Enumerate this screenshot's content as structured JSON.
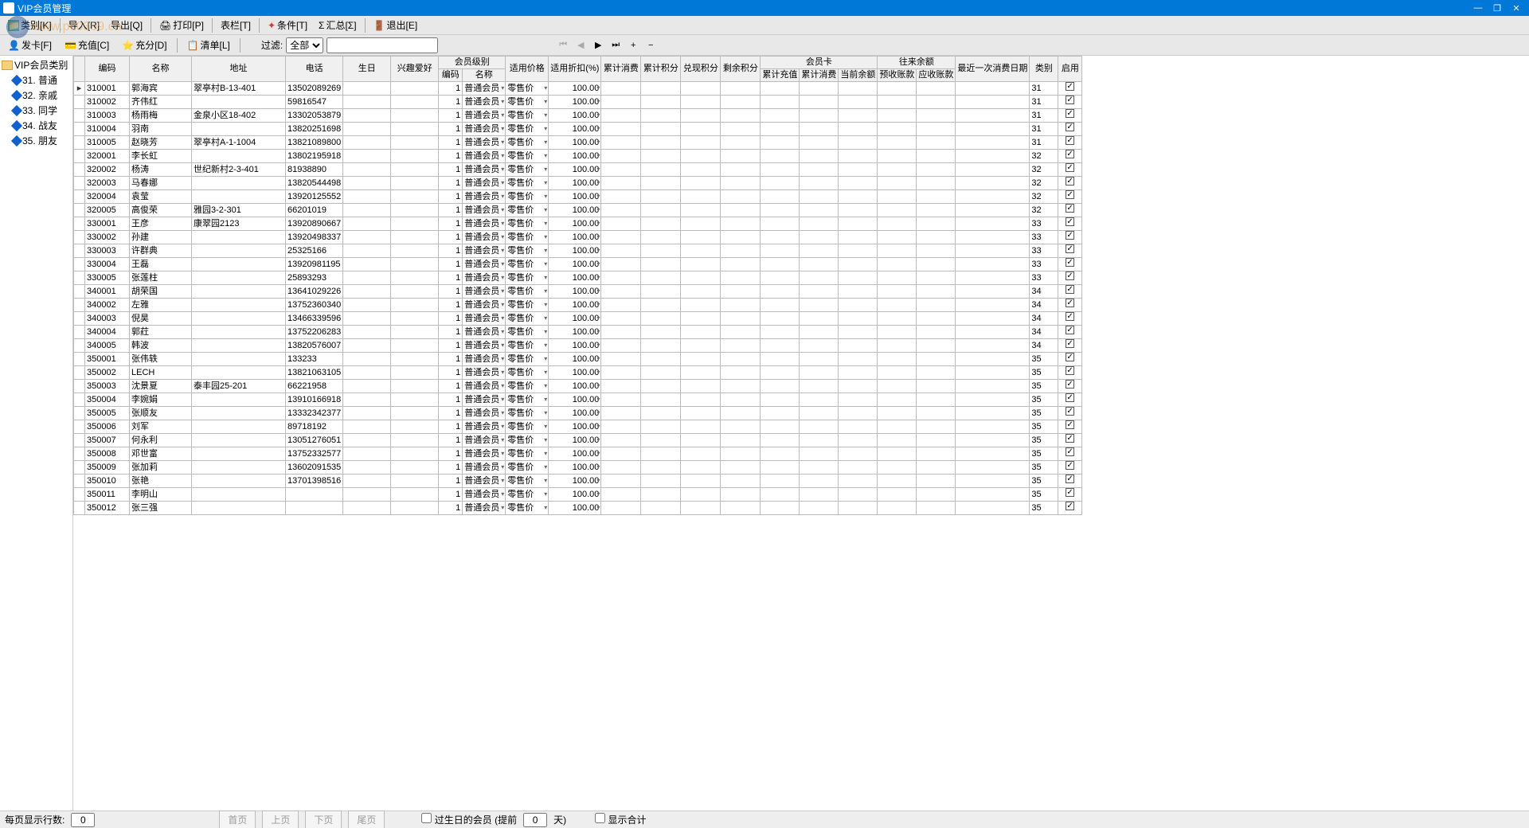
{
  "window": {
    "title": "VIP会员管理"
  },
  "watermark": "www.pc0359.cn",
  "toolbar1": {
    "category": "类别[K]",
    "import": "导入[R]",
    "export": "导出[Q]",
    "print": "打印[P]",
    "format": "表栏[T]",
    "condition": "条件[T]",
    "summary": "汇总[Σ]",
    "exit": "退出[E]"
  },
  "toolbar2": {
    "issue": "发卡[F]",
    "recharge": "充值[C]",
    "points": "充分[D]",
    "list": "清单[L]",
    "filter_label": "过滤:",
    "filter_all": "全部"
  },
  "tree": {
    "root": "VIP会员类别",
    "items": [
      "31. 普通",
      "32. 亲戚",
      "33. 同学",
      "34. 战友",
      "35. 朋友"
    ]
  },
  "cols": {
    "code": "编码",
    "name": "名称",
    "addr": "地址",
    "phone": "电话",
    "birth": "生日",
    "hobby": "兴趣爱好",
    "level": "会员级别",
    "lv_code": "编码",
    "lv_name": "名称",
    "price": "适用价格",
    "disc": "适用折扣(%)",
    "tot_cons": "累计消费",
    "tot_pts": "累计积分",
    "redeem": "兑现积分",
    "remain": "剩余积分",
    "card": "会员卡",
    "c_recharge": "累计充值",
    "c_cons": "累计消费",
    "c_bal": "当前余额",
    "bal": "往来余额",
    "prepay": "预收账款",
    "pay": "应收账款",
    "last": "最近一次消费日期",
    "cat": "类别",
    "enable": "启用"
  },
  "level_name": "普通会员",
  "price_name": "零售价",
  "disc_val": "100.00",
  "rows": [
    {
      "code": "310001",
      "name": "郭海宾",
      "addr": "翠亭村B-13-401",
      "phone": "13502089269",
      "cat": "31"
    },
    {
      "code": "310002",
      "name": "齐伟红",
      "addr": "",
      "phone": "59816547",
      "cat": "31"
    },
    {
      "code": "310003",
      "name": "杨雨梅",
      "addr": "金泉小区18-402",
      "phone": "13302053879",
      "cat": "31"
    },
    {
      "code": "310004",
      "name": "羽南",
      "addr": "",
      "phone": "13820251698",
      "cat": "31"
    },
    {
      "code": "310005",
      "name": "赵晓芳",
      "addr": "翠亭村A-1-1004",
      "phone": "13821089800",
      "cat": "31"
    },
    {
      "code": "320001",
      "name": "李长虹",
      "addr": "",
      "phone": "13802195918",
      "cat": "32"
    },
    {
      "code": "320002",
      "name": "杨涛",
      "addr": "世纪新村2-3-401",
      "phone": "81938890",
      "cat": "32"
    },
    {
      "code": "320003",
      "name": "马春娜",
      "addr": "",
      "phone": "13820544498",
      "cat": "32"
    },
    {
      "code": "320004",
      "name": "袁莹",
      "addr": "",
      "phone": "13920125552",
      "cat": "32"
    },
    {
      "code": "320005",
      "name": "高俊荣",
      "addr": "雅园3-2-301",
      "phone": "66201019",
      "cat": "32"
    },
    {
      "code": "330001",
      "name": "王彦",
      "addr": "康翠园2123",
      "phone": "13920890667",
      "cat": "33"
    },
    {
      "code": "330002",
      "name": "孙建",
      "addr": "",
      "phone": "13920498337",
      "cat": "33"
    },
    {
      "code": "330003",
      "name": "许群典",
      "addr": "",
      "phone": "25325166",
      "cat": "33"
    },
    {
      "code": "330004",
      "name": "王磊",
      "addr": "",
      "phone": "13920981195",
      "cat": "33"
    },
    {
      "code": "330005",
      "name": "张莲柱",
      "addr": "",
      "phone": "25893293",
      "cat": "33"
    },
    {
      "code": "340001",
      "name": "胡荣国",
      "addr": "",
      "phone": "13641029226",
      "cat": "34"
    },
    {
      "code": "340002",
      "name": "左雅",
      "addr": "",
      "phone": "13752360340",
      "cat": "34"
    },
    {
      "code": "340003",
      "name": "倪昊",
      "addr": "",
      "phone": "13466339596",
      "cat": "34"
    },
    {
      "code": "340004",
      "name": "郭荭",
      "addr": "",
      "phone": "13752206283",
      "cat": "34"
    },
    {
      "code": "340005",
      "name": "韩波",
      "addr": "",
      "phone": "13820576007",
      "cat": "34"
    },
    {
      "code": "350001",
      "name": "张伟轶",
      "addr": "",
      "phone": "133233",
      "cat": "35"
    },
    {
      "code": "350002",
      "name": "LECH",
      "addr": "",
      "phone": "13821063105",
      "cat": "35"
    },
    {
      "code": "350003",
      "name": "沈景夏",
      "addr": "泰丰园25-201",
      "phone": "66221958",
      "cat": "35"
    },
    {
      "code": "350004",
      "name": "李婉娟",
      "addr": "",
      "phone": "13910166918",
      "cat": "35"
    },
    {
      "code": "350005",
      "name": "张顺友",
      "addr": "",
      "phone": "13332342377",
      "cat": "35"
    },
    {
      "code": "350006",
      "name": "刘军",
      "addr": "",
      "phone": "89718192",
      "cat": "35"
    },
    {
      "code": "350007",
      "name": "何永利",
      "addr": "",
      "phone": "13051276051",
      "cat": "35"
    },
    {
      "code": "350008",
      "name": "邓世富",
      "addr": "",
      "phone": "13752332577",
      "cat": "35"
    },
    {
      "code": "350009",
      "name": "张加莉",
      "addr": "",
      "phone": "13602091535",
      "cat": "35"
    },
    {
      "code": "350010",
      "name": "张艳",
      "addr": "",
      "phone": "13701398516",
      "cat": "35"
    },
    {
      "code": "350011",
      "name": "李明山",
      "addr": "",
      "phone": "",
      "cat": "35"
    },
    {
      "code": "350012",
      "name": "张三强",
      "addr": "",
      "phone": "",
      "cat": "35"
    }
  ],
  "footer": {
    "pagesize_label": "每页显示行数:",
    "pagesize": "0",
    "first": "首页",
    "prev": "上页",
    "next": "下页",
    "last": "尾页",
    "birthday": "过生日的会员 (提前",
    "birthday_days": "0",
    "birthday_suffix": "天)",
    "show_total": "显示合计"
  }
}
